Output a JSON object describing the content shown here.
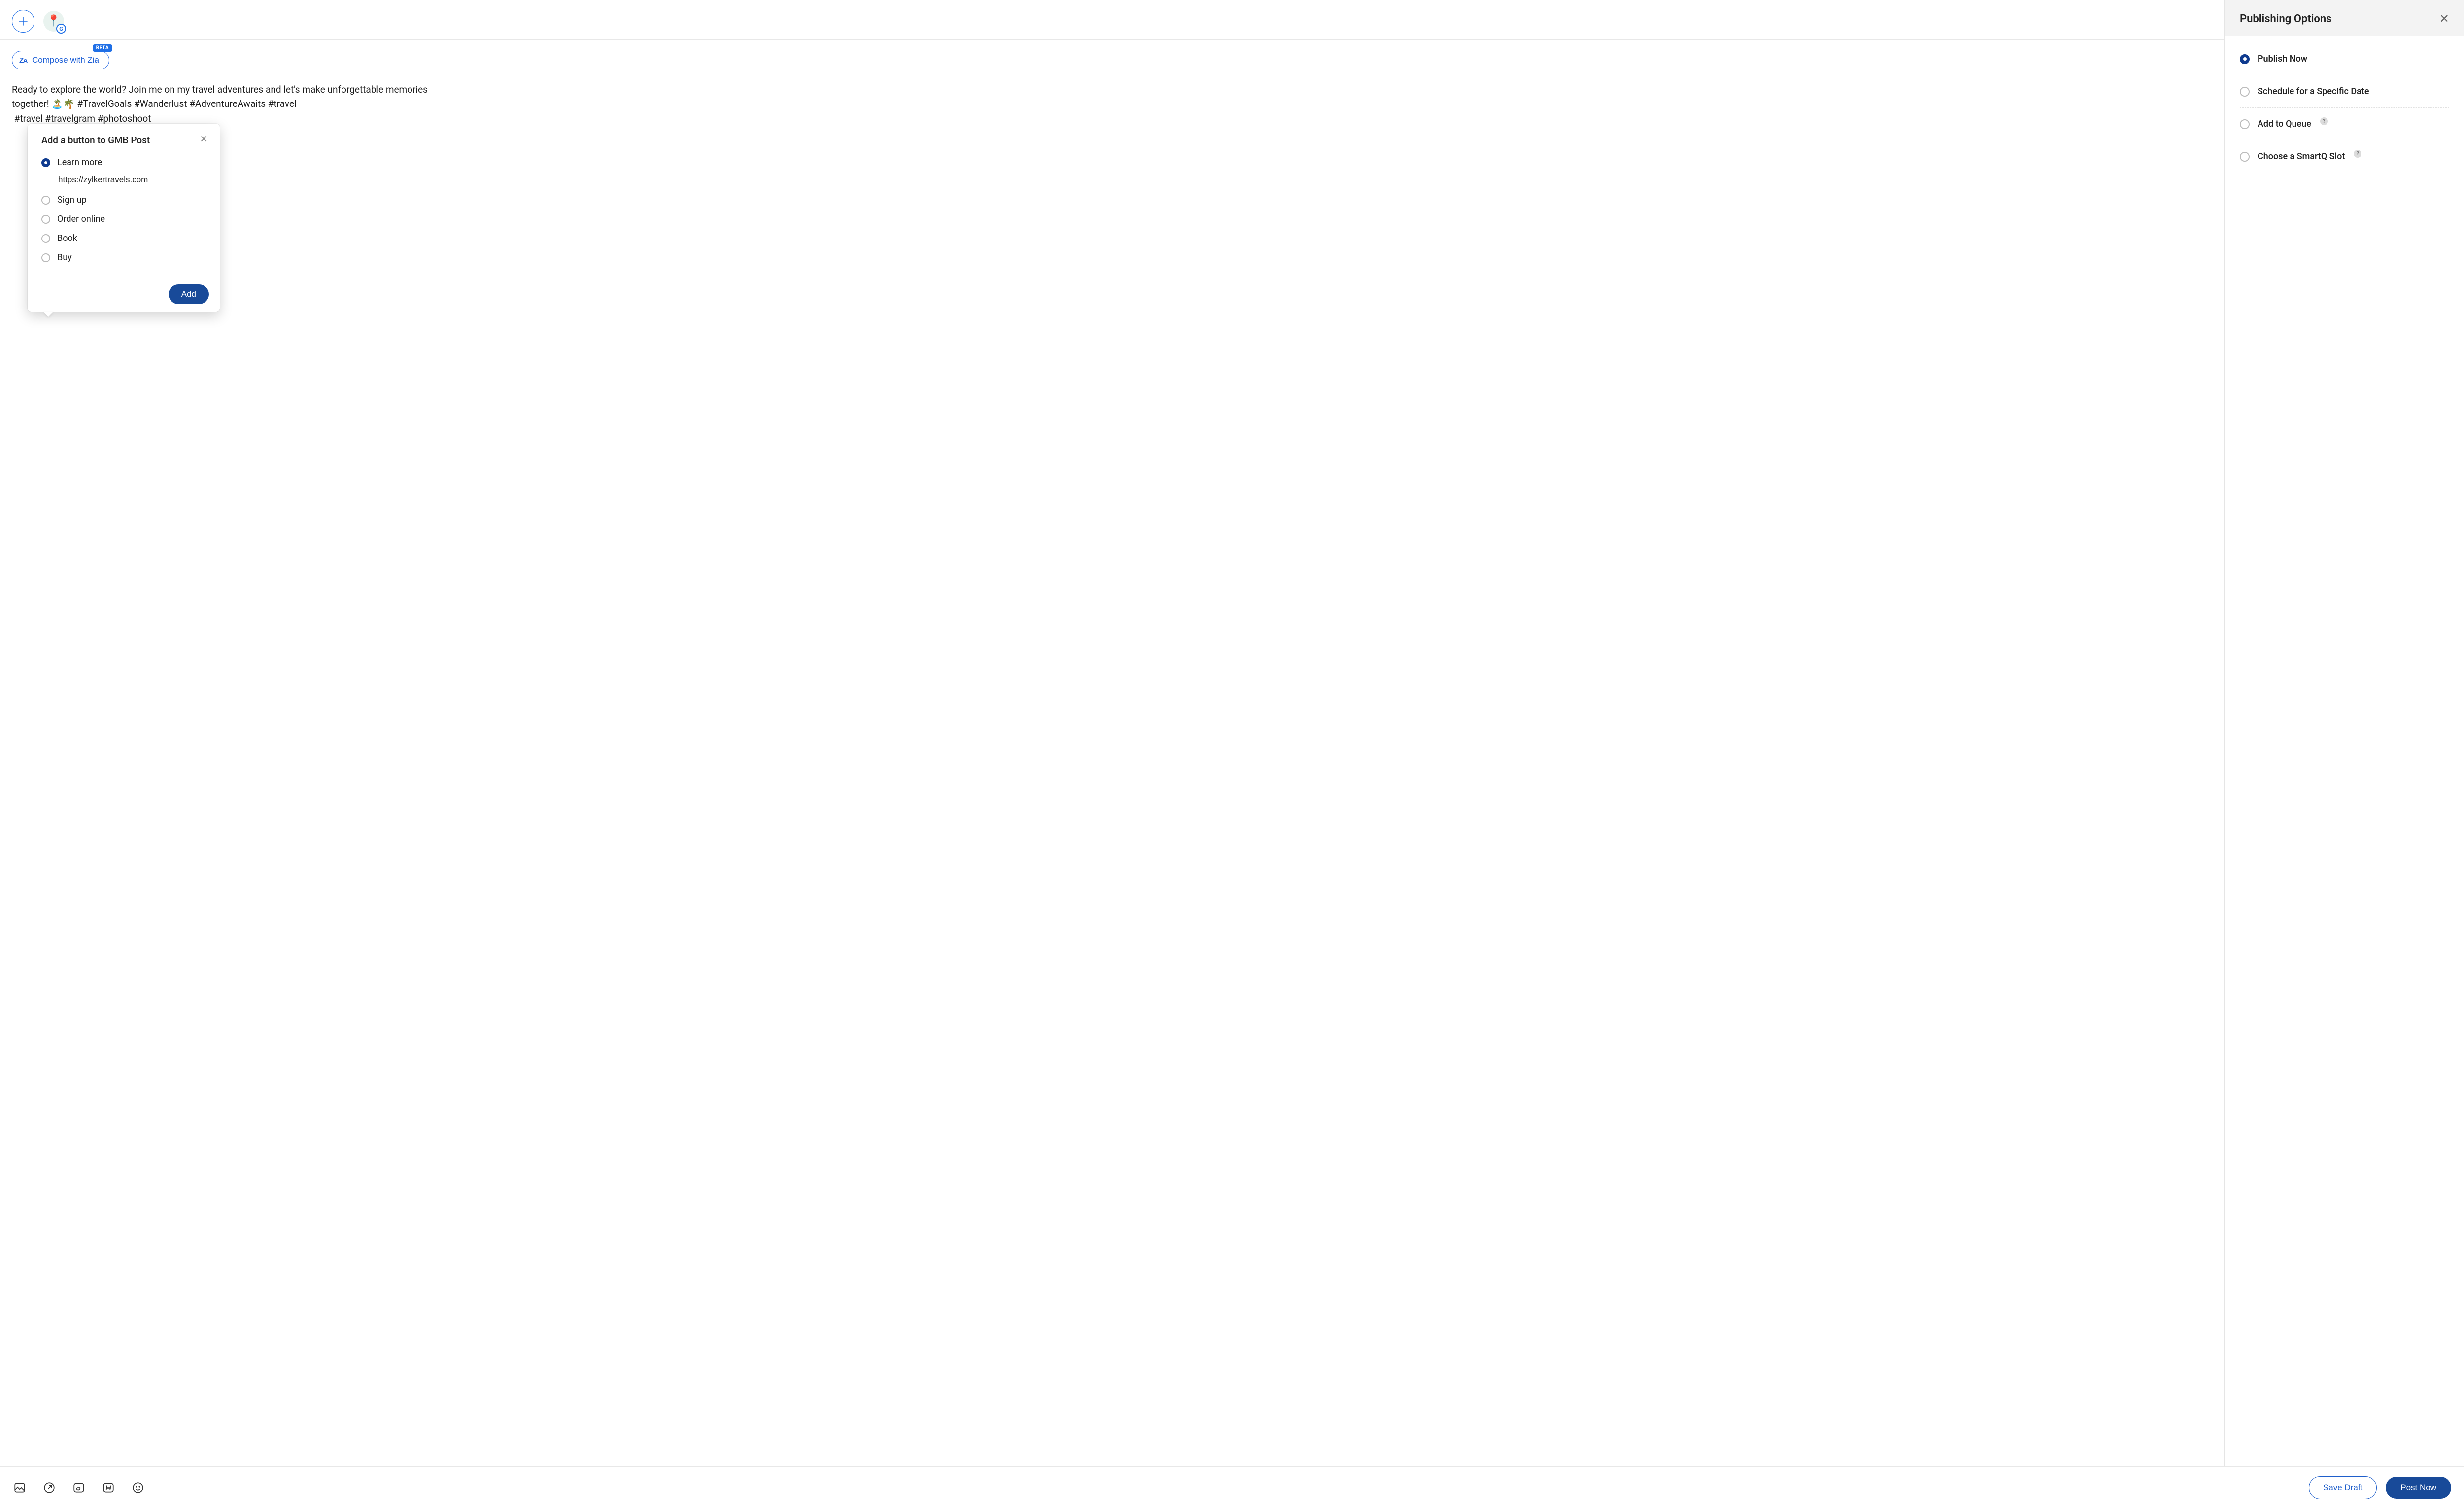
{
  "header": {
    "add_account_label": "+",
    "account_mini_badge": "G"
  },
  "compose": {
    "pill_label": "Compose with Zia",
    "pill_glyph": "Zᴀ",
    "beta_label": "BETA",
    "post_text": "Ready to explore the world? Join me on my travel adventures and let's make unforgettable memories together! 🏝️🌴 #TravelGoals #Wanderlust #AdventureAwaits #travel\n #travel #travelgram #photoshoot"
  },
  "popover": {
    "title": "Add a button to GMB Post",
    "close_glyph": "✕",
    "options": [
      {
        "label": "Learn more",
        "selected": true
      },
      {
        "label": "Sign up",
        "selected": false
      },
      {
        "label": "Order online",
        "selected": false
      },
      {
        "label": "Book",
        "selected": false
      },
      {
        "label": "Buy",
        "selected": false
      }
    ],
    "url_value": "https://zylkertravels.com",
    "add_label": "Add"
  },
  "toolbar_icons": {
    "image": "image-icon",
    "link": "link-arrow-icon",
    "gmb": "gmb-icon",
    "hashtag": "hashtag-icon",
    "emoji": "emoji-icon"
  },
  "side": {
    "title": "Publishing Options",
    "close_glyph": "✕",
    "options": [
      {
        "label": "Publish Now",
        "selected": true,
        "help": false
      },
      {
        "label": "Schedule for a Specific Date",
        "selected": false,
        "help": false
      },
      {
        "label": "Add to Queue",
        "selected": false,
        "help": true
      },
      {
        "label": "Choose a SmartQ Slot",
        "selected": false,
        "help": true
      }
    ],
    "help_glyph": "?"
  },
  "footer": {
    "save_draft": "Save Draft",
    "post_now": "Post Now"
  }
}
